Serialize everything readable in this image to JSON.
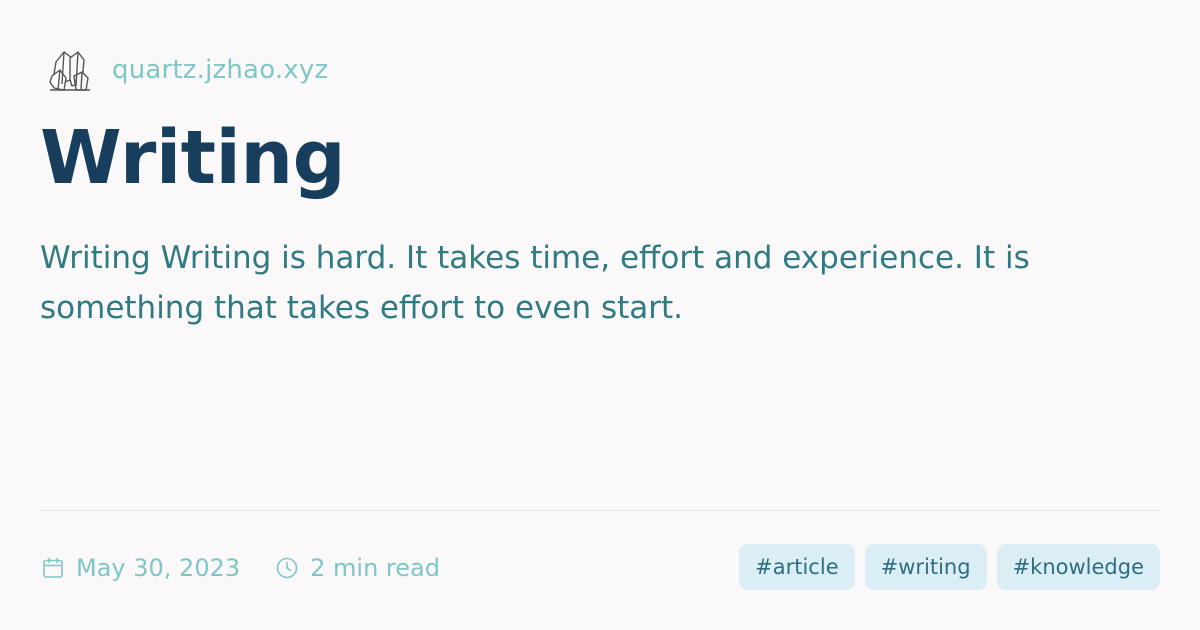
{
  "site": {
    "url_text": "quartz.jzhao.xyz",
    "logo_icon": "crystal-icon"
  },
  "page": {
    "title": "Writing",
    "description": "Writing Writing is hard. It takes time, effort and experience. It is something that takes effort to even start."
  },
  "meta": {
    "date": "May 30, 2023",
    "date_icon": "calendar-icon",
    "reading_time": "2 min read",
    "reading_icon": "clock-icon"
  },
  "tags": [
    "#article",
    "#writing",
    "#knowledge"
  ],
  "colors": {
    "background": "#faf8f8",
    "title": "#173f5d",
    "body_text": "#2f7a83",
    "accent": "#7fc6c7",
    "tag_background": "#dceef5",
    "tag_text": "#2f6d82"
  }
}
